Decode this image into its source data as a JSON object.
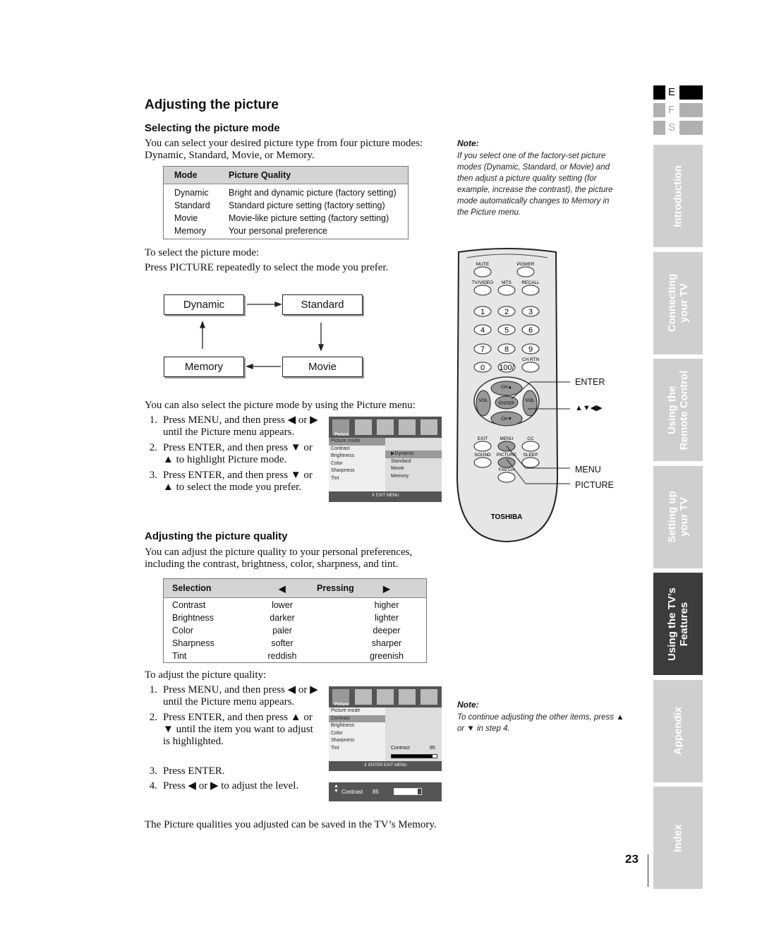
{
  "title": "Adjusting the picture",
  "section1": {
    "heading": "Selecting the picture mode",
    "intro": [
      "You can select your desired picture type from four picture modes:",
      "Dynamic, Standard, Movie, or Memory."
    ],
    "table": {
      "headers": [
        "Mode",
        "Picture Quality"
      ],
      "rows": [
        [
          "Dynamic",
          "Bright and dynamic picture (factory setting)"
        ],
        [
          "Standard",
          "Standard picture setting (factory setting)"
        ],
        [
          "Movie",
          "Movie-like picture setting (factory setting)"
        ],
        [
          "Memory",
          "Your personal preference"
        ]
      ]
    },
    "select_label": "To select the picture mode:",
    "select_instruction": "Press PICTURE repeatedly to select the mode you prefer.",
    "flow": [
      "Dynamic",
      "Standard",
      "Movie",
      "Memory"
    ],
    "menu_intro": "You can also select the picture mode by using the Picture menu:",
    "steps": [
      {
        "n": "1.",
        "lines": [
          "Press MENU, and then press ◀ or ▶",
          "until the Picture menu appears."
        ]
      },
      {
        "n": "2.",
        "lines": [
          "Press ENTER, and then press ▼ or",
          "▲ to highlight Picture mode."
        ]
      },
      {
        "n": "3.",
        "lines": [
          "Press ENTER, and then press ▼ or",
          "▲  to select the mode you prefer."
        ]
      }
    ],
    "menu": {
      "tab": "Picture",
      "items": [
        "Picture mode",
        "Contrast",
        "Brightness",
        "Color",
        "Sharpness",
        "Tint"
      ],
      "options": [
        "Dynamic",
        "Standard",
        "Movie",
        "Memory"
      ],
      "selected_option": "Dynamic",
      "footer": "⇕ EXIT MENU"
    }
  },
  "section2": {
    "heading": "Adjusting the picture quality",
    "intro": [
      "You can adjust the picture quality to your personal preferences,",
      "including the contrast, brightness, color, sharpness, and tint."
    ],
    "table": {
      "headers": [
        "Selection",
        "◀",
        "Pressing",
        "▶"
      ],
      "rows": [
        [
          "Contrast",
          "lower",
          "higher"
        ],
        [
          "Brightness",
          "darker",
          "lighter"
        ],
        [
          "Color",
          "paler",
          "deeper"
        ],
        [
          "Sharpness",
          "softer",
          "sharper"
        ],
        [
          "Tint",
          "reddish",
          "greenish"
        ]
      ]
    },
    "adjust_label": "To adjust the picture quality:",
    "steps": [
      {
        "n": "1.",
        "lines": [
          "Press MENU, and then press ◀ or ▶",
          "until the Picture menu appears."
        ]
      },
      {
        "n": "2.",
        "lines": [
          "Press ENTER, and then press ▲ or",
          "▼ until the item you want to adjust",
          "is highlighted."
        ]
      },
      {
        "n": "3.",
        "lines": [
          "Press ENTER."
        ]
      },
      {
        "n": "4.",
        "lines": [
          "Press ◀ or ▶ to adjust the level."
        ]
      }
    ],
    "menu": {
      "tab": "Picture",
      "items": [
        "Picture mode",
        "Contrast",
        "Brightness",
        "Color",
        "Sharpness",
        "Tint"
      ],
      "selected_item": "Contrast",
      "level_label": "Contrast",
      "level_value": "85",
      "level_percent": 90,
      "footer": "⇕ ENTER EXIT MENU"
    },
    "bar": {
      "label": "Contrast",
      "value": "85",
      "level_percent": 88
    },
    "closing": "The Picture qualities you adjusted can be saved in the TV’s Memory."
  },
  "note1": {
    "heading": "Note:",
    "lines": [
      "If you select one of the factory-set picture",
      "modes (Dynamic, Standard, or Movie) and",
      "then adjust a picture quality setting (for",
      "example, increase the contrast), the picture",
      "mode automatically changes to Memory in",
      "the Picture menu."
    ]
  },
  "note2": {
    "heading": "Note:",
    "lines": [
      "To continue adjusting the other items, press ▲",
      "or ▼ in step 4."
    ]
  },
  "remote": {
    "brand": "TOSHIBA",
    "buttons": [
      "MUTE",
      "POWER",
      "TV/VIDEO",
      "MTS",
      "RECALL",
      "1",
      "2",
      "3",
      "4",
      "5",
      "6",
      "7",
      "8",
      "9",
      "0",
      "100/",
      "CH RTN",
      "CH▲",
      "CH▼",
      "VOL",
      "ENTER",
      "VOL",
      "EXIT",
      "MENU",
      "CC",
      "SOUND",
      "PICTURE",
      "SLEEP",
      "FAV.CH"
    ],
    "callouts": [
      "ENTER",
      "▲▼◀▶",
      "MENU",
      "PICTURE"
    ]
  },
  "languages": [
    {
      "code": "E",
      "active": true
    },
    {
      "code": "F",
      "active": false
    },
    {
      "code": "S",
      "active": false
    }
  ],
  "tabs": [
    {
      "label": [
        "Introduction"
      ],
      "active": false
    },
    {
      "label": [
        "Connecting",
        "your TV"
      ],
      "active": false
    },
    {
      "label": [
        "Using the",
        "Remote Control"
      ],
      "active": false
    },
    {
      "label": [
        "Setting up",
        "your TV"
      ],
      "active": false
    },
    {
      "label": [
        "Using the TV’s",
        "Features"
      ],
      "active": true
    },
    {
      "label": [
        "Appendix"
      ],
      "active": false
    },
    {
      "label": [
        "Index"
      ],
      "active": false
    }
  ],
  "page_number": "23",
  "colors": {
    "active_tab": "#3c3c3c",
    "inactive_tab": "#cfcfcf",
    "table_header": "#d4d4d4"
  }
}
